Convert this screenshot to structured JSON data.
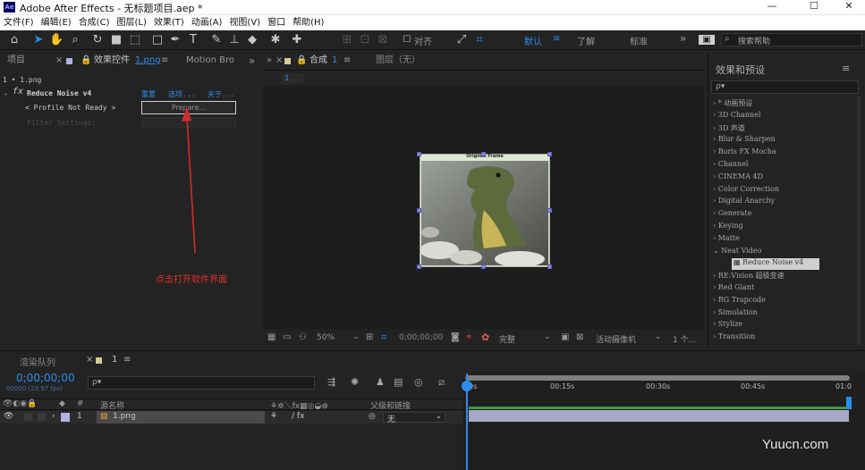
{
  "window": {
    "title": "Adobe After Effects - 无标题项目.aep *",
    "app_icon": "Ae",
    "minimize": "—",
    "maximize": "☐",
    "close": "✕"
  },
  "menu": [
    "文件(F)",
    "编辑(E)",
    "合成(C)",
    "图层(L)",
    "效果(T)",
    "动画(A)",
    "视图(V)",
    "窗口",
    "帮助(H)"
  ],
  "toolbar": {
    "align_label": "对齐",
    "workspaces": [
      "默认",
      "了解",
      "标准"
    ],
    "more": "»",
    "search_help_placeholder": "搜索帮助"
  },
  "left_panel": {
    "tab_project": "项目",
    "tab_effects": "效果控件",
    "tab_effects_file": "1.png",
    "tab_motion": "Motion Bro",
    "breadcrumb": "1 • 1.png",
    "effect_name": "Reduce Noise v4",
    "reset": "重置",
    "options": "选项...",
    "about": "关于...",
    "profile_row": "< Profile Not Ready >",
    "prepare": "Prepare...",
    "filter_settings": "Filter Settings:",
    "annotation": "点击打开软件界面"
  },
  "comp_panel": {
    "tab_comp": "合成",
    "tab_comp_name": "1",
    "tab_layer": "图层（无）",
    "comp_chip": "1",
    "frame_label": "Original Frame",
    "zoom": "50%",
    "timecode": "0;00;00;00",
    "quality": "完整",
    "camera": "活动摄像机",
    "views": "1 个..."
  },
  "right_panel": {
    "title": "效果和预设",
    "search_placeholder": "ρ▾",
    "items": [
      {
        "label": "* 动画预设",
        "indent": 0
      },
      {
        "label": "3D Channel",
        "indent": 0
      },
      {
        "label": "3D 声道",
        "indent": 0
      },
      {
        "label": "Blur & Sharpen",
        "indent": 0
      },
      {
        "label": "Boris FX Mocha",
        "indent": 0
      },
      {
        "label": "Channel",
        "indent": 0
      },
      {
        "label": "CINEMA 4D",
        "indent": 0
      },
      {
        "label": "Color Correction",
        "indent": 0
      },
      {
        "label": "Digital Anarchy",
        "indent": 0
      },
      {
        "label": "Generate",
        "indent": 0
      },
      {
        "label": "Keying",
        "indent": 0
      },
      {
        "label": "Matte",
        "indent": 0
      },
      {
        "label": "Neat Video",
        "indent": 0,
        "expanded": true
      },
      {
        "label": "Reduce Noise v4",
        "indent": 1,
        "selected": true
      },
      {
        "label": "RE:Vision 超级变速",
        "indent": 0
      },
      {
        "label": "Red Giant",
        "indent": 0
      },
      {
        "label": "RG Trapcode",
        "indent": 0
      },
      {
        "label": "Simulation",
        "indent": 0
      },
      {
        "label": "Stylize",
        "indent": 0
      },
      {
        "label": "Transition",
        "indent": 0
      }
    ]
  },
  "timeline": {
    "tab_render": "渲染队列",
    "tab_comp": "1",
    "timecode": "0;00;00;00",
    "fps_info": "00000 (29.97 fps)",
    "search_placeholder": "ρ▾",
    "col_num": "#",
    "col_name": "源名称",
    "col_parent": "父级和链接",
    "layer_num": "1",
    "layer_name": "1.png",
    "parent_value": "无",
    "ruler": [
      "0s",
      "00:15s",
      "00:30s",
      "00:45s",
      "01:0"
    ]
  },
  "watermark": "Yuucn.com",
  "colors": {
    "accent": "#2d8ceb",
    "arrow": "#d22b2b",
    "layer_bar": "#a7a7c7",
    "annotation": "#e0302a"
  }
}
